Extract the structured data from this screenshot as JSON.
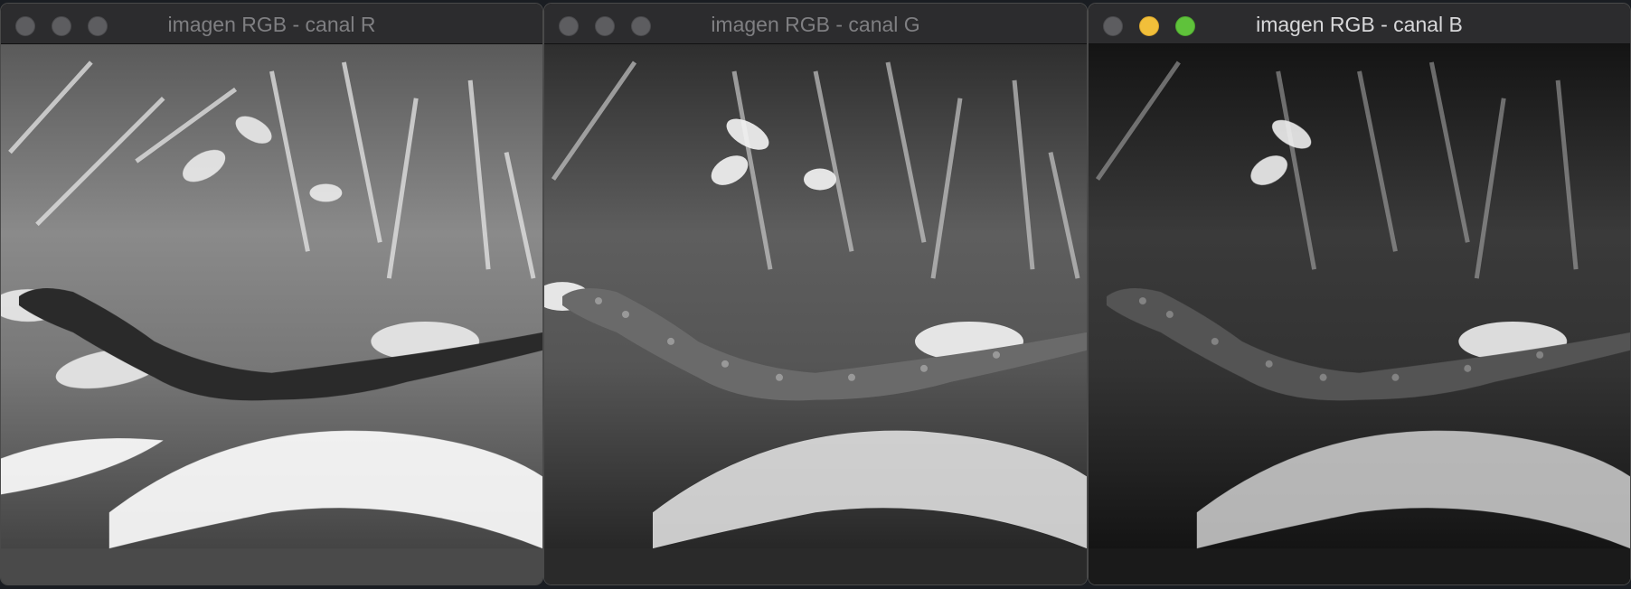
{
  "windows": [
    {
      "title": "imagen RGB - canal R",
      "active": false,
      "image": {
        "subject": "grayscale red-channel photo of a lizard among leaves and grass",
        "tone": "bright"
      }
    },
    {
      "title": "imagen RGB - canal G",
      "active": false,
      "image": {
        "subject": "grayscale green-channel photo of a lizard among leaves and grass",
        "tone": "medium"
      }
    },
    {
      "title": "imagen RGB - canal B",
      "active": true,
      "image": {
        "subject": "grayscale blue-channel photo of a lizard among leaves and grass",
        "tone": "dark"
      }
    }
  ],
  "colors": {
    "titlebar": "#2c2c2e",
    "close_inactive": "#5d5d60",
    "minimize_active": "#f1bf3a",
    "zoom_active": "#5fc23b"
  },
  "icons": [
    "close-icon",
    "minimize-icon",
    "zoom-icon"
  ]
}
